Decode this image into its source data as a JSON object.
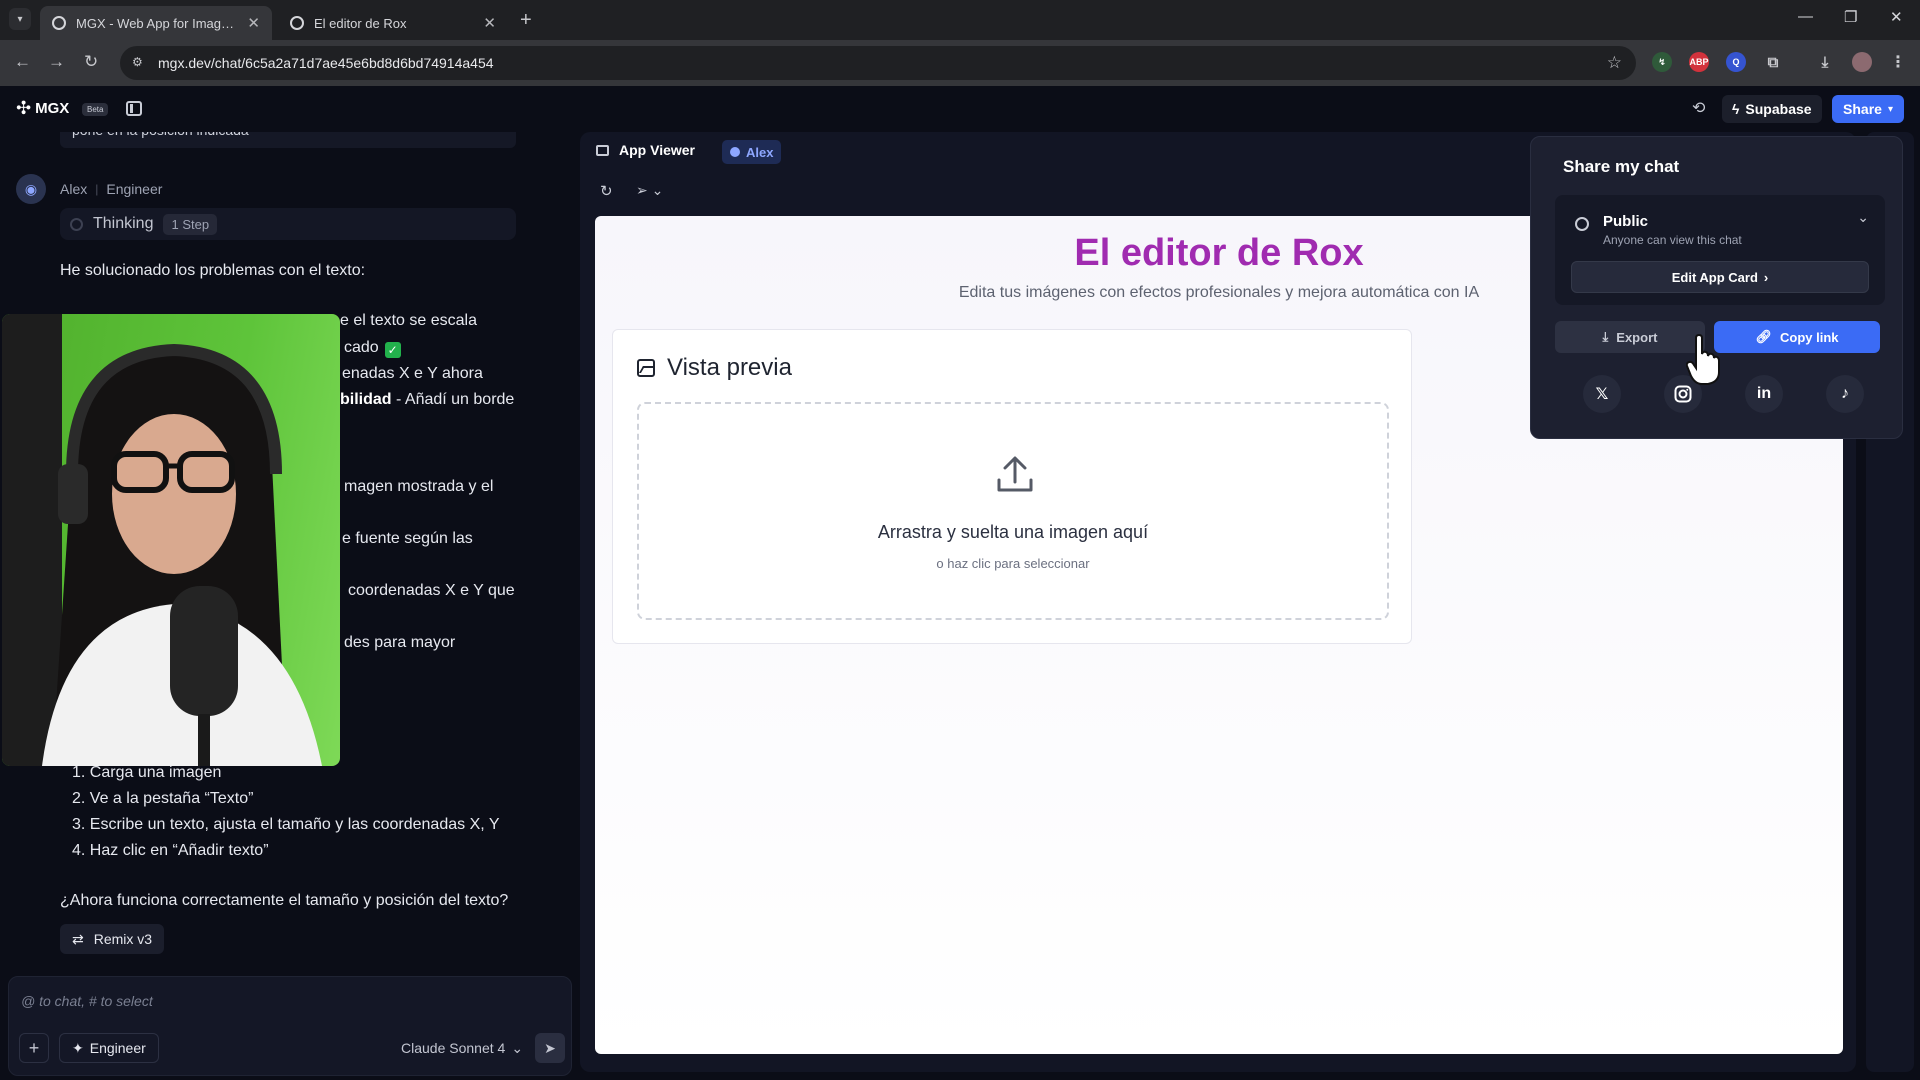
{
  "browser": {
    "tabs": [
      {
        "title": "MGX - Web App for Image Editi",
        "active": true
      },
      {
        "title": "El editor de Rox",
        "active": false
      }
    ],
    "url": "mgx.dev/chat/6c5a2a71d7ae45e6bd8d6bd74914a454"
  },
  "header": {
    "logo": "MGX",
    "beta": "Beta",
    "supabase": "Supabase",
    "share": "Share"
  },
  "chat": {
    "prev_message": "pone en la posición indicada",
    "agent": {
      "name": "Alex",
      "role": "Engineer"
    },
    "thinking": {
      "label": "Thinking",
      "steps": "1 Step"
    },
    "intro": "He solucionado los problemas con el texto:",
    "lines": [
      {
        "pre": "",
        "bold": "",
        "text": "e el texto se escala"
      },
      {
        "pre": "",
        "bold": "",
        "text": "cado"
      },
      {
        "pre": "",
        "bold": "",
        "text": "enadas X e Y ahora"
      },
      {
        "pre": "",
        "bold": "bilidad",
        "text": " - Añadí un borde"
      },
      {
        "pre": "",
        "bold": "",
        "text": "magen mostrada y el"
      },
      {
        "pre": "",
        "bold": "",
        "text": "e fuente según las"
      },
      {
        "pre": "",
        "bold": "",
        "text": "coordenadas X e Y que"
      },
      {
        "pre": "",
        "bold": "",
        "text": "des para mayor"
      }
    ],
    "steps": [
      "1. Carga una imagen",
      "2. Ve a la pestaña “Texto”",
      "3. Escribe un texto, ajusta el tamaño y las coordenadas X, Y",
      "4. Haz clic en “Añadir texto”"
    ],
    "question": "¿Ahora funciona correctamente el tamaño y posición del texto?",
    "remix": "Remix v3",
    "composer": {
      "placeholder": "@ to chat, # to select",
      "agent_button": "Engineer",
      "model": "Claude Sonnet 4"
    }
  },
  "viewer": {
    "title": "App Viewer",
    "agent_badge": "Alex"
  },
  "app": {
    "title": "El editor de Rox",
    "subtitle": "Edita tus imágenes con efectos profesionales y mejora automática con IA",
    "preview_title": "Vista previa",
    "drop_main": "Arrastra y suelta una imagen aquí",
    "drop_sub": "o haz clic para seleccionar"
  },
  "share_popover": {
    "title": "Share my chat",
    "visibility_label": "Public",
    "visibility_desc": "Anyone can view this chat",
    "edit_card": "Edit App Card",
    "export": "Export",
    "copy_link": "Copy link",
    "socials": [
      "X",
      "Instagram",
      "LinkedIn",
      "TikTok"
    ]
  },
  "colors": {
    "accent": "#3b6bf5",
    "app_title": "#a02bb0",
    "check": "#22b14c",
    "webcam_green": "#5ec43a"
  }
}
